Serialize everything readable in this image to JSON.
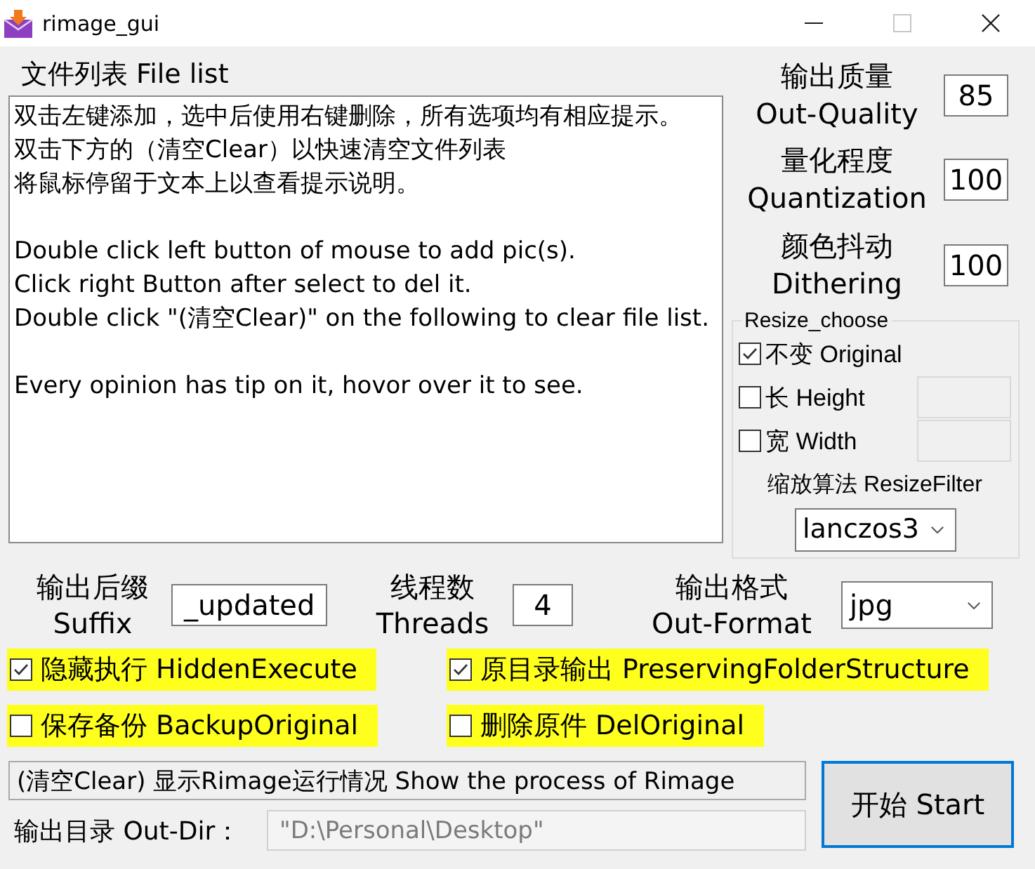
{
  "window": {
    "title": "rimage_gui",
    "buttons": [
      {
        "kind": "minimize",
        "disabled": false
      },
      {
        "kind": "maximize",
        "disabled": true
      },
      {
        "kind": "close",
        "disabled": false
      }
    ]
  },
  "file_list": {
    "label": "文件列表 File list",
    "paragraphs": [
      [
        "双击左键添加，选中后使用右键删除，所有选项均有相应提示。",
        "双击下方的（清空Clear）以快速清空文件列表",
        "将鼠标停留于文本上以查看提示说明。"
      ],
      [
        "Double click left button of mouse to add pic(s).",
        "Click right Button after select to del it.",
        "Double click \"(清空Clear)\" on the following to clear file list."
      ],
      [
        "Every opinion has tip on it, hovor over it to see."
      ]
    ]
  },
  "settings": [
    {
      "label_cn": "输出质量",
      "label_en": "Out-Quality",
      "value": "85"
    },
    {
      "label_cn": "量化程度",
      "label_en": "Quantization",
      "value": "100"
    },
    {
      "label_cn": "颜色抖动",
      "label_en": "Dithering",
      "value": "100"
    }
  ],
  "resize_choose": {
    "title": "Resize_choose",
    "options": [
      {
        "kind": "plain",
        "label": "不变 Original",
        "checked": true
      },
      {
        "kind": "size",
        "label": "长 Height",
        "checked": false,
        "field_disabled": true
      },
      {
        "kind": "size",
        "label": "宽 Width",
        "checked": false,
        "field_disabled": true
      }
    ],
    "filter_label": "缩放算法 ResizeFilter",
    "filter_value": "lanczos3"
  },
  "output_options": [
    {
      "kind": "text",
      "label_cn": "输出后缀",
      "label_en": "Suffix",
      "value": "_updated"
    },
    {
      "kind": "text",
      "label_cn": "线程数",
      "label_en": "Threads",
      "value": "4"
    },
    {
      "kind": "select",
      "label_cn": "输出格式",
      "label_en": "Out-Format",
      "value": "jpg"
    }
  ],
  "flags": [
    {
      "label": "隐藏执行 HiddenExecute",
      "checked": true,
      "highlighted": true
    },
    {
      "label": "原目录输出 PreservingFolderStructure",
      "checked": true,
      "highlighted": true
    },
    {
      "label": "保存备份 BackupOriginal",
      "checked": false,
      "highlighted": true
    },
    {
      "label": "删除原件 DelOriginal",
      "checked": false,
      "highlighted": true
    }
  ],
  "status": {
    "text": "(清空Clear) 显示Rimage运行情况 Show the process of Rimage"
  },
  "out_dir": {
    "label": "输出目录 Out-Dir：",
    "value": "\"D:\\Personal\\Desktop\"",
    "disabled": true
  },
  "start_button": {
    "label": "开始 Start",
    "focused": true
  }
}
